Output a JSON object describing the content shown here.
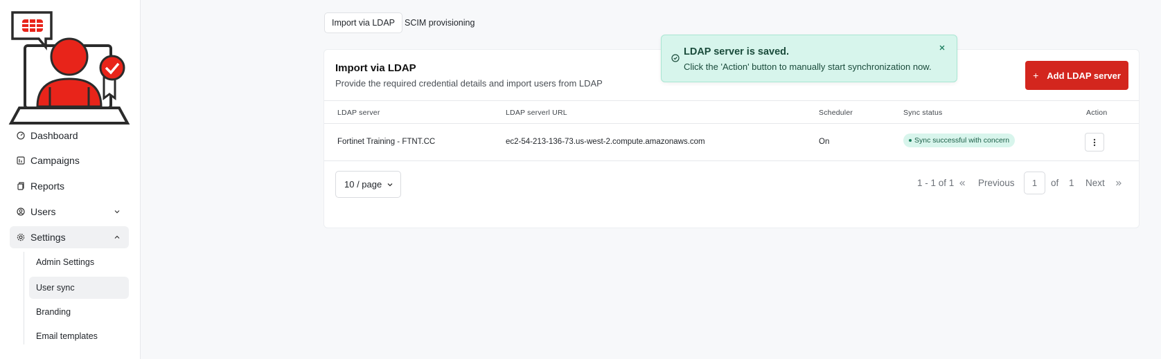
{
  "sidebar": {
    "items": [
      {
        "label": "Dashboard",
        "icon": "dashboard-icon"
      },
      {
        "label": "Campaigns",
        "icon": "campaigns-icon"
      },
      {
        "label": "Reports",
        "icon": "reports-icon"
      },
      {
        "label": "Users",
        "icon": "users-icon"
      },
      {
        "label": "Settings",
        "icon": "gear-icon"
      }
    ],
    "settings_sub": [
      {
        "label": "Admin Settings"
      },
      {
        "label": "User sync"
      },
      {
        "label": "Branding"
      },
      {
        "label": "Email templates"
      }
    ]
  },
  "tabs": [
    {
      "label": "Import via LDAP"
    },
    {
      "label": "SCIM provisioning"
    }
  ],
  "card": {
    "title": "Import via LDAP",
    "subtitle": "Provide the required credential details and import users from LDAP",
    "add_button": "Add LDAP server"
  },
  "table": {
    "headers": [
      "LDAP server",
      "LDAP serverl URL",
      "Scheduler",
      "Sync status",
      "Action"
    ],
    "rows": [
      {
        "server": "Fortinet Training - FTNT.CC",
        "url": "ec2-54-213-136-73.us-west-2.compute.amazonaws.com",
        "scheduler": "On",
        "sync_status": "Sync successful with concern"
      }
    ]
  },
  "pagination": {
    "page_size": "10 / page",
    "range": "1 - 1 of 1",
    "previous": "Previous",
    "current_page": "1",
    "of": "of",
    "total_pages": "1",
    "next": "Next"
  },
  "toast": {
    "title": "LDAP server is saved.",
    "message": "Click the 'Action' button to manually start synchronization now."
  },
  "colors": {
    "accent": "#d3261e",
    "success_bg": "#d7f5ec",
    "success_text": "#1a4b3b"
  }
}
